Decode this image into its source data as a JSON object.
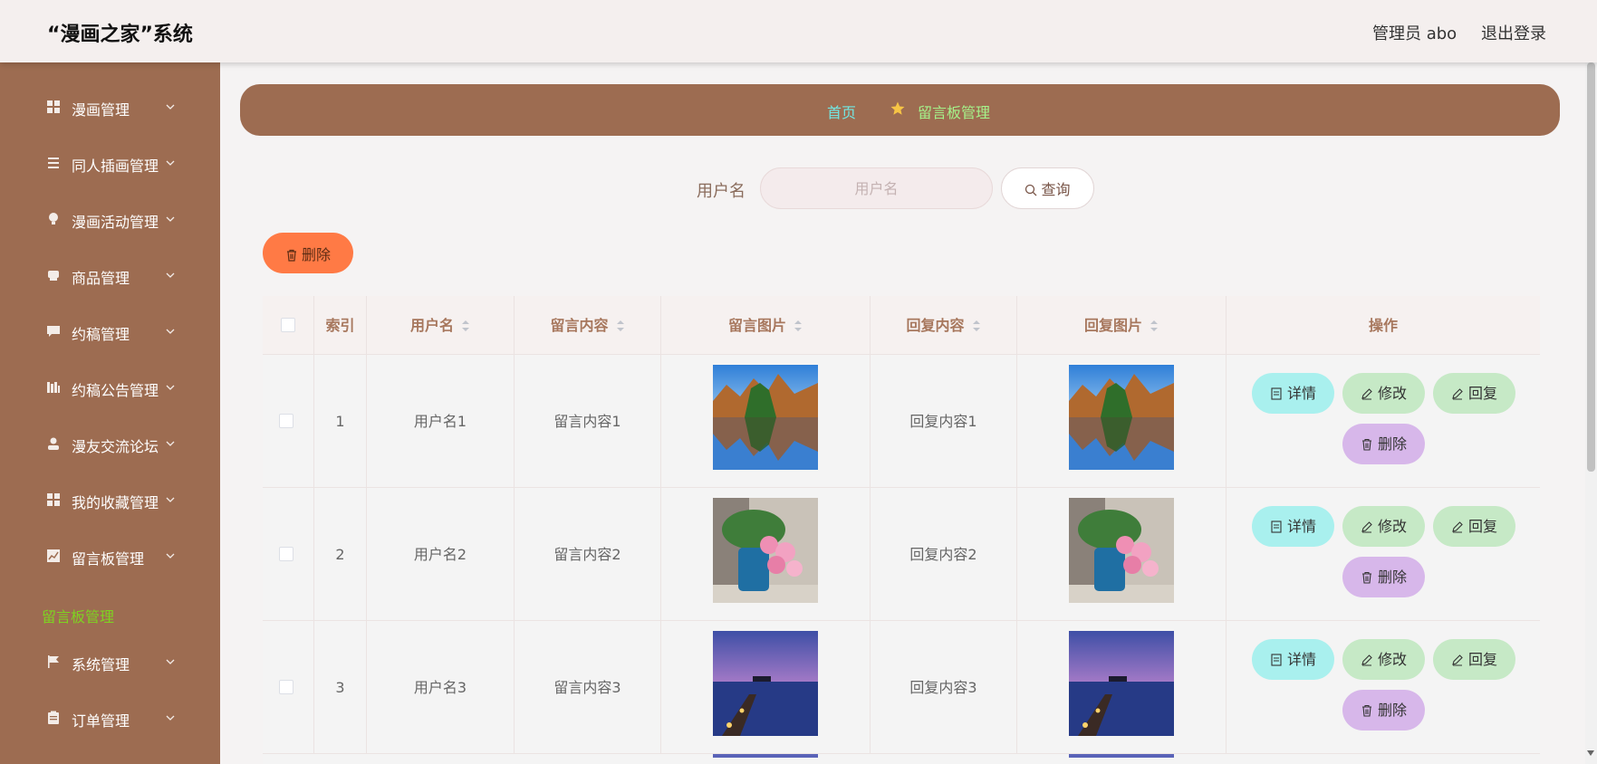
{
  "header": {
    "title": "“漫画之家”系统",
    "user": "管理员 abo",
    "logout": "退出登录"
  },
  "sidebar": {
    "items": [
      {
        "label": "漫画管理",
        "icon": "grid-icon"
      },
      {
        "label": "同人插画管理",
        "icon": "list-icon"
      },
      {
        "label": "漫画活动管理",
        "icon": "bulb-icon"
      },
      {
        "label": "商品管理",
        "icon": "box-icon"
      },
      {
        "label": "约稿管理",
        "icon": "chat-icon"
      },
      {
        "label": "约稿公告管理",
        "icon": "books-icon"
      },
      {
        "label": "漫友交流论坛",
        "icon": "user-icon"
      },
      {
        "label": "我的收藏管理",
        "icon": "grid-icon"
      },
      {
        "label": "留言板管理",
        "icon": "chart-icon"
      },
      {
        "label": "系统管理",
        "icon": "flag-icon"
      },
      {
        "label": "订单管理",
        "icon": "clipboard-icon"
      }
    ],
    "active_sub": "留言板管理"
  },
  "breadcrumb": {
    "home": "首页",
    "current": "留言板管理"
  },
  "search": {
    "label": "用户名",
    "placeholder": "用户名",
    "button": "查询"
  },
  "toolbar": {
    "delete": "删除"
  },
  "table": {
    "columns": [
      "索引",
      "用户名",
      "留言内容",
      "留言图片",
      "回复内容",
      "回复图片",
      "操作"
    ],
    "rows": [
      {
        "index": "1",
        "username": "用户名1",
        "content": "留言内容1",
        "reply": "回复内容1",
        "image": "lake-landscape"
      },
      {
        "index": "2",
        "username": "用户名2",
        "content": "留言内容2",
        "reply": "回复内容2",
        "image": "pink-roses-vase"
      },
      {
        "index": "3",
        "username": "用户名3",
        "content": "留言内容3",
        "reply": "回复内容3",
        "image": "pier-at-dusk"
      }
    ],
    "actions": {
      "detail": "详情",
      "edit": "修改",
      "reply": "回复",
      "delete": "删除"
    }
  },
  "colors": {
    "sidebar_bg": "#9d6c51",
    "header_bg": "#f4efee",
    "breadcrumb_home": "#72e7e3",
    "breadcrumb_current": "#a5f28a",
    "delete_button": "#ff7a45",
    "detail_button": "#a9f0ee",
    "edit_button": "#c6e9c6",
    "row_delete_button": "#d7b7ea"
  }
}
